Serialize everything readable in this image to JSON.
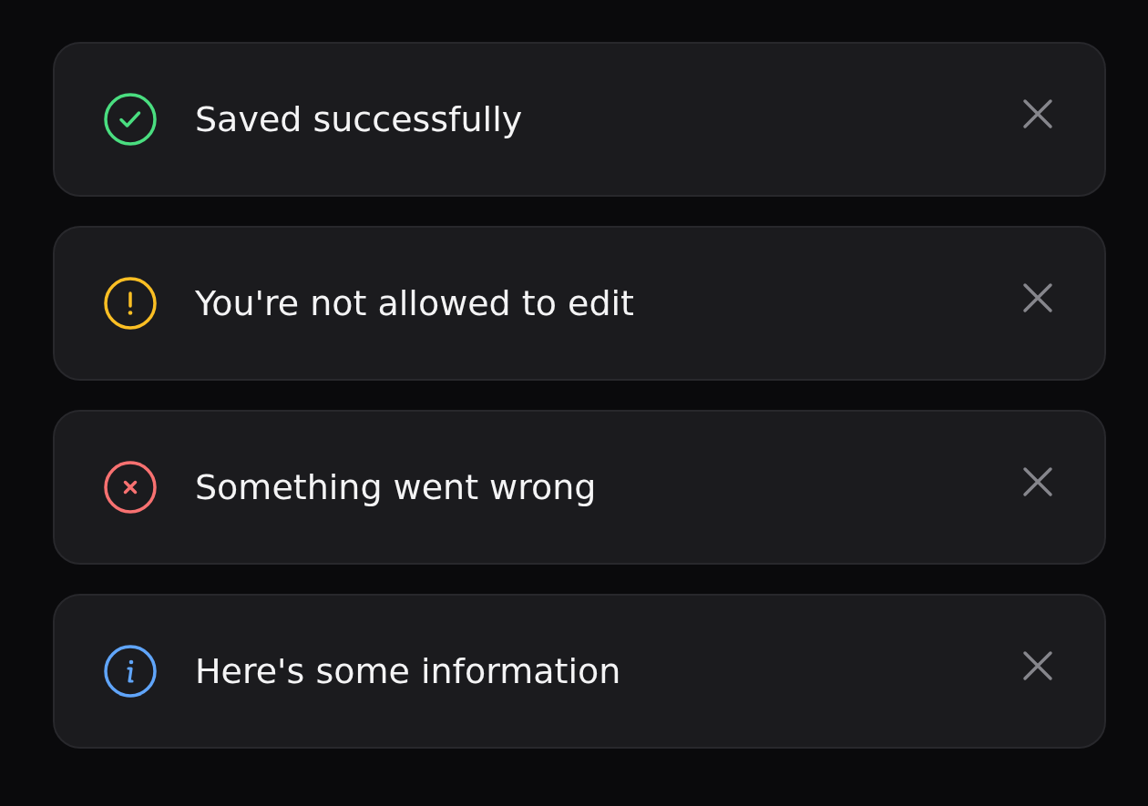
{
  "toasts": [
    {
      "kind": "success",
      "color": "#4ade80",
      "message": "Saved successfully"
    },
    {
      "kind": "warning",
      "color": "#fbbf24",
      "message": "You're not allowed to edit"
    },
    {
      "kind": "error",
      "color": "#f87171",
      "message": "Something went wrong"
    },
    {
      "kind": "info",
      "color": "#60a5fa",
      "message": "Here's some information"
    }
  ]
}
